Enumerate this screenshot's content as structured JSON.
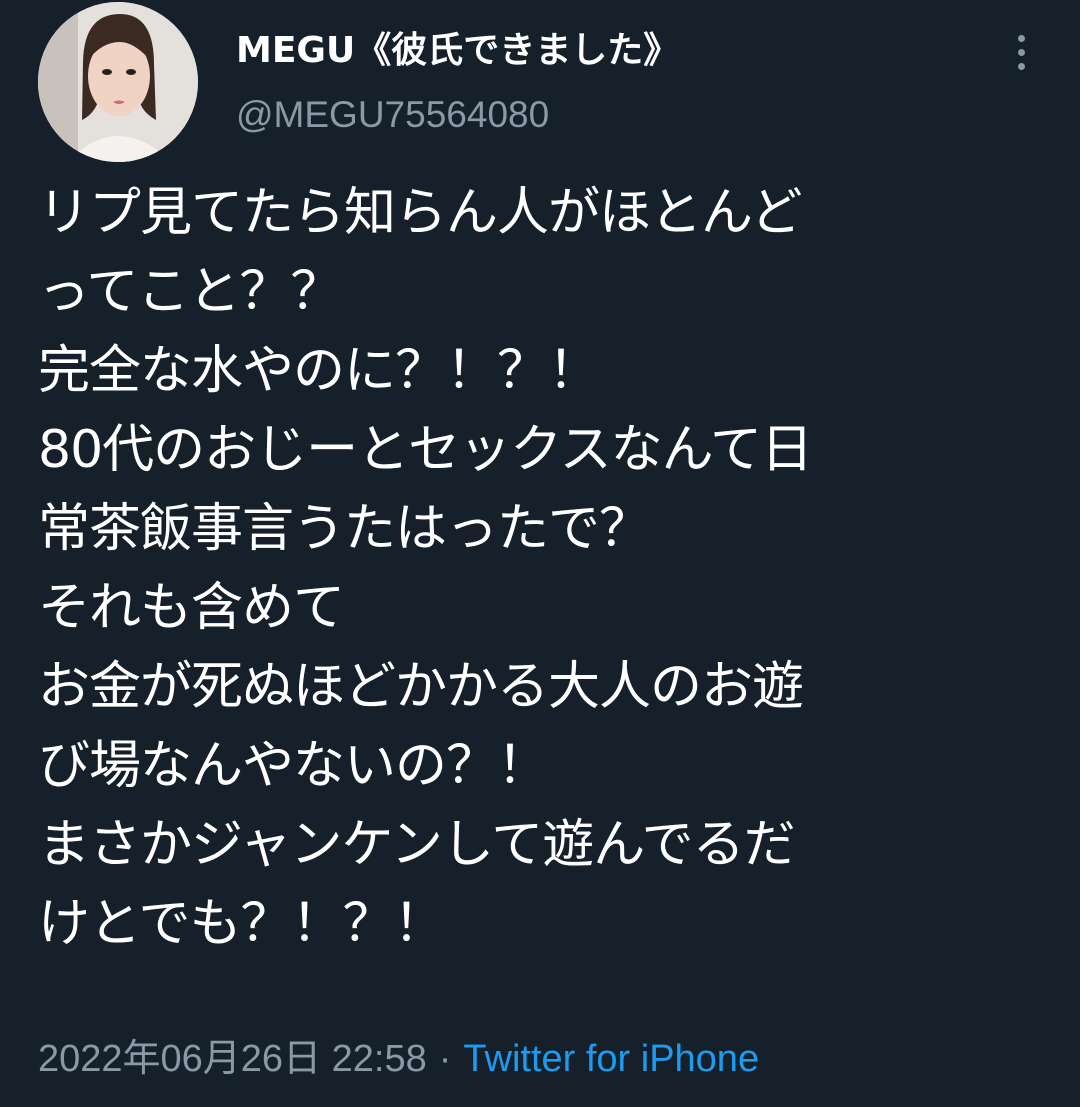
{
  "author": {
    "display_name": "MEGU《彼氏できました》",
    "handle": "@MEGU75564080",
    "avatar_icon": "user-avatar-photo"
  },
  "more_icon": "more-vertical-icon",
  "tweet": {
    "lines": [
      "リプ見てたら知らん人がほとんど",
      "ってこと？？",
      "完全な水やのに？！？！",
      "80代のおじーとセックスなんて日",
      "常茶飯事言うたはったで？",
      "それも含めて",
      "お金が死ぬほどかかる大人のお遊",
      "び場なんやないの？！",
      "まさかジャンケンして遊んでるだ",
      "けとでも？！？！"
    ]
  },
  "meta": {
    "timestamp": "2022年06月26日 22:58",
    "separator": "·",
    "source": "Twitter for iPhone"
  },
  "colors": {
    "background": "#15202b",
    "text": "#ffffff",
    "secondary": "#8b98a5",
    "accent": "#1d9bf0"
  }
}
